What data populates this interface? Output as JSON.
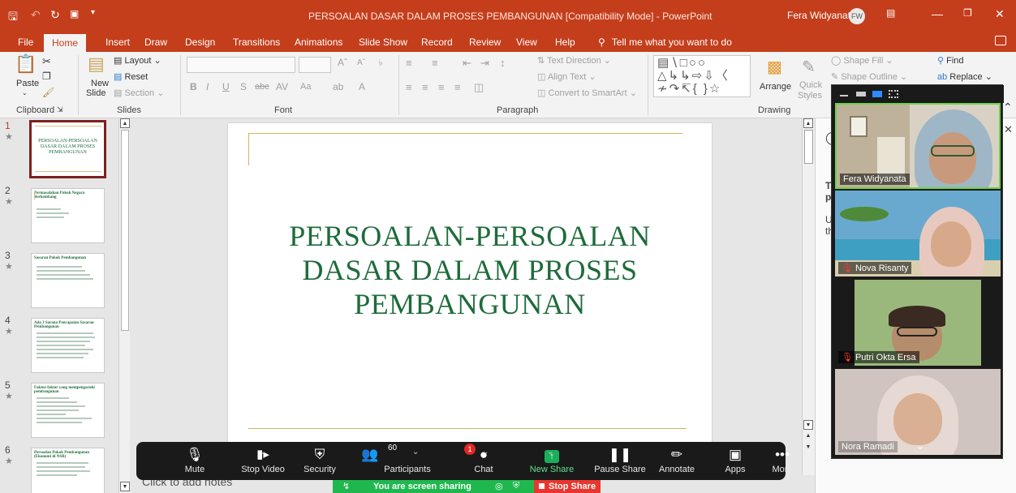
{
  "titlebar": {
    "title": "PERSOALAN DASAR DALAM PROSES PEMBANGUNAN [Compatibility Mode] - PowerPoint",
    "user": "Fera Widyanata",
    "user_initials": "FW"
  },
  "tabs": [
    "File",
    "Home",
    "Insert",
    "Draw",
    "Design",
    "Transitions",
    "Animations",
    "Slide Show",
    "Record",
    "Review",
    "View",
    "Help"
  ],
  "tell_me": "Tell me what you want to do",
  "ribbon": {
    "paste": "Paste",
    "clipboard": "Clipboard",
    "new_slide": "New",
    "new_slide2": "Slide",
    "layout": "Layout",
    "reset": "Reset",
    "section": "Section",
    "slides": "Slides",
    "font": "Font",
    "paragraph": "Paragraph",
    "text_direction": "Text Direction",
    "align_text": "Align Text",
    "convert_smartart": "Convert to SmartArt",
    "arrange": "Arrange",
    "quick": "Quick",
    "styles": "Styles",
    "drawing": "Drawing",
    "shape_fill": "Shape Fill",
    "shape_outline": "Shape Outline",
    "find": "Find",
    "replace": "Replace"
  },
  "slides": [
    {
      "num": "1",
      "title": "PERSOALAN-PERSOALAN DASAR DALAM PROSES PEMBANGUNAN"
    },
    {
      "num": "2",
      "title": "Permasalahan Pokok Negara Berkembang"
    },
    {
      "num": "3",
      "title": "Sasaran Pokok Pembangunan"
    },
    {
      "num": "4",
      "title": "Ada 3 Sarana Pencapaian Sasaran Pembangunan"
    },
    {
      "num": "5",
      "title": "Faktor-faktor yang mempengaruhi pembangunan"
    },
    {
      "num": "6",
      "title": "Persoalan Pokok Pembangunan (Ekonomi di NSB)"
    }
  ],
  "slide": {
    "title_line1": "PERSOALAN-PERSOALAN",
    "title_line2": "DASAR DALAM PROSES",
    "title_line3": "PEMBANGUNAN"
  },
  "notes_placeholder": "Click to add notes",
  "right_pane": {
    "a": "T",
    "b": "p",
    "c": "U",
    "d": "th"
  },
  "participants": [
    {
      "name": "Fera Widyanata",
      "muted": false
    },
    {
      "name": "Nova Risanty",
      "muted": true
    },
    {
      "name": "Putri Okta Ersa",
      "muted": true
    },
    {
      "name": "Nora Ramadi",
      "muted": false
    }
  ],
  "zoom_toolbar": {
    "mute": "Mute",
    "stop_video": "Stop Video",
    "security": "Security",
    "participants": "Participants",
    "participants_count": "60",
    "chat": "Chat",
    "chat_badge": "1",
    "new_share": "New Share",
    "pause_share": "Pause Share",
    "annotate": "Annotate",
    "apps": "Apps",
    "more": "More"
  },
  "share_banner": {
    "text": "You are screen sharing",
    "stop": "Stop Share"
  }
}
